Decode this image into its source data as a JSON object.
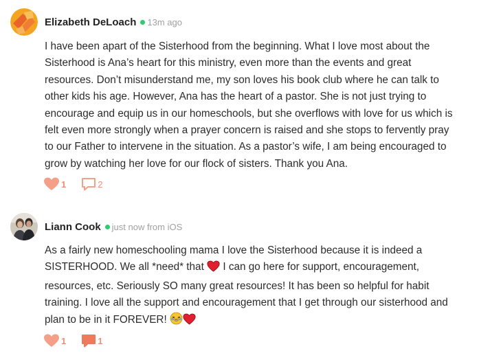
{
  "posts": [
    {
      "author": "Elizabeth DeLoach",
      "meta": "13m ago",
      "avatar_icon": "orange-abstract-avatar",
      "lines": [
        "I have been apart of the Sisterhood from the beginning.  What I love most about the",
        "Sisterhood is Ana’s heart for this ministry, even more than the events and great",
        "resources.  Don’t misunderstand me, my son loves his book club where he can talk to",
        "other kids his age.  However, Ana has the heart of a pastor.  She is not just trying to",
        "encourage and equip us in our homeschools, but she overflows with love for us which is",
        "felt even more strongly when a prayer concern is raised and she stops to fervently pray",
        "to our Father to intervene in the situation.  As a pastor’s wife, I am being encouraged to",
        "grow by watching her love for our flock of sisters. Thank you Ana."
      ],
      "likes": "1",
      "comments": "2"
    },
    {
      "author": "Liann Cook",
      "meta": "just now from iOS",
      "avatar_icon": "photo-avatar",
      "lines": [
        "As a fairly new homeschooling mama I love the Sisterhood because it is indeed a",
        "SISTERHOOD. We all *need* that",
        "I can go here for support, encouragement,",
        "resources, etc. Seriously SO many great resources! It has been so helpful for habit",
        "training. I love all the support and encouragement that I get through our sisterhood and",
        "plan to be in it FOREVER!"
      ],
      "likes": "1",
      "comments": "1"
    }
  ],
  "colors": {
    "accent": "#f08f77",
    "online": "#2ecc71",
    "heart_emoji": "#e0202e",
    "meta_text": "#a0a0a0"
  }
}
